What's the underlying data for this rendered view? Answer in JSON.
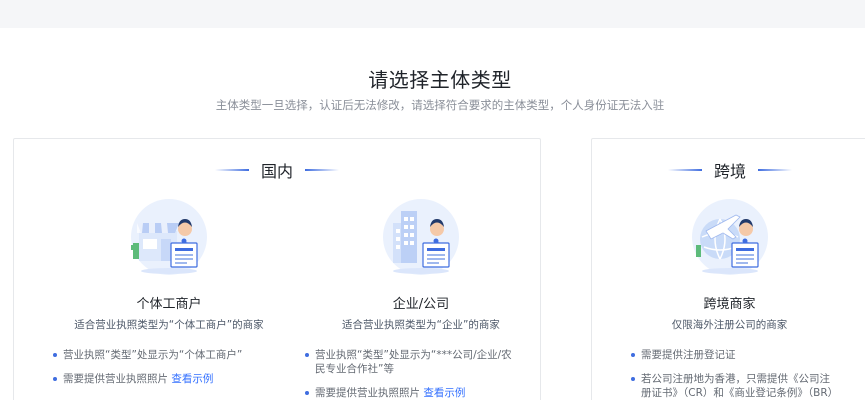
{
  "header": {
    "title": "请选择主体类型",
    "subtitle": "主体类型一旦选择，认证后无法修改，请选择符合要求的主体类型，个人身份证无法入驻"
  },
  "domestic": {
    "heading": "国内",
    "options": [
      {
        "title": "个体工商户",
        "desc": "适合营业执照类型为“个体工商户”的商家",
        "bullets": [
          {
            "text": "营业执照“类型”处显示为“个体工商户”"
          },
          {
            "text": "需要提供营业执照照片",
            "link": "查看示例"
          }
        ]
      },
      {
        "title": "企业/公司",
        "desc": "适合营业执照类型为“企业”的商家",
        "bullets": [
          {
            "text": "营业执照“类型”处显示为“***公司/企业/农民专业合作社”等"
          },
          {
            "text": "需要提供营业执照照片",
            "link": "查看示例"
          }
        ]
      }
    ]
  },
  "cross_border": {
    "heading": "跨境",
    "options": [
      {
        "title": "跨境商家",
        "desc": "仅限海外注册公司的商家",
        "bullets": [
          {
            "text": "需要提供注册登记证"
          },
          {
            "text": "若公司注册地为香港，只需提供《公司注册证书》（CR）和《商业登记条例》（BR）"
          }
        ]
      }
    ]
  },
  "colors": {
    "accent": "#3f6de0",
    "link": "#3370ff",
    "illustration_bg": "#eaf1fd"
  },
  "icons": [
    "shop-illustration-icon",
    "company-building-illustration-icon",
    "globe-plane-illustration-icon"
  ]
}
